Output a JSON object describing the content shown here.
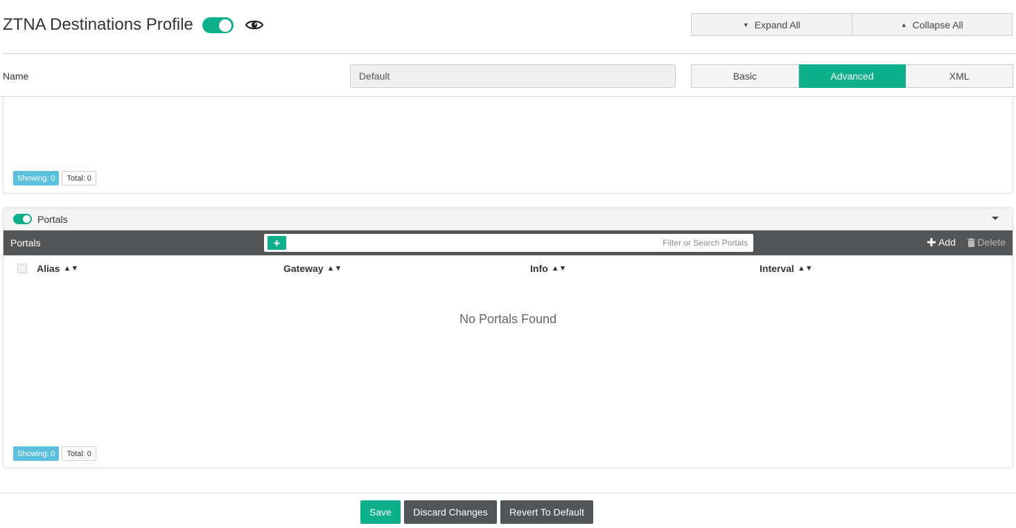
{
  "header": {
    "title": "ZTNA Destinations Profile",
    "expand_all": "Expand All",
    "collapse_all": "Collapse All"
  },
  "name_row": {
    "label": "Name",
    "value": "Default",
    "modes": [
      "Basic",
      "Advanced",
      "XML"
    ],
    "active_mode": "Advanced"
  },
  "top_panel": {
    "showing": "Showing: 0",
    "total": "Total: 0"
  },
  "portals_panel": {
    "heading": "Portals",
    "enabled": true,
    "grid_title": "Portals",
    "search_placeholder": "Filter or Search Portals",
    "add_label": "Add",
    "delete_label": "Delete",
    "columns": [
      "Alias",
      "Gateway",
      "Info",
      "Interval"
    ],
    "empty_message": "No Portals Found",
    "showing": "Showing: 0",
    "total": "Total: 0"
  },
  "footer": {
    "save": "Save",
    "discard": "Discard Changes",
    "revert": "Revert To Default"
  },
  "colors": {
    "accent": "#0db08a",
    "toolbar": "#535557",
    "info_badge": "#5bc0de"
  }
}
